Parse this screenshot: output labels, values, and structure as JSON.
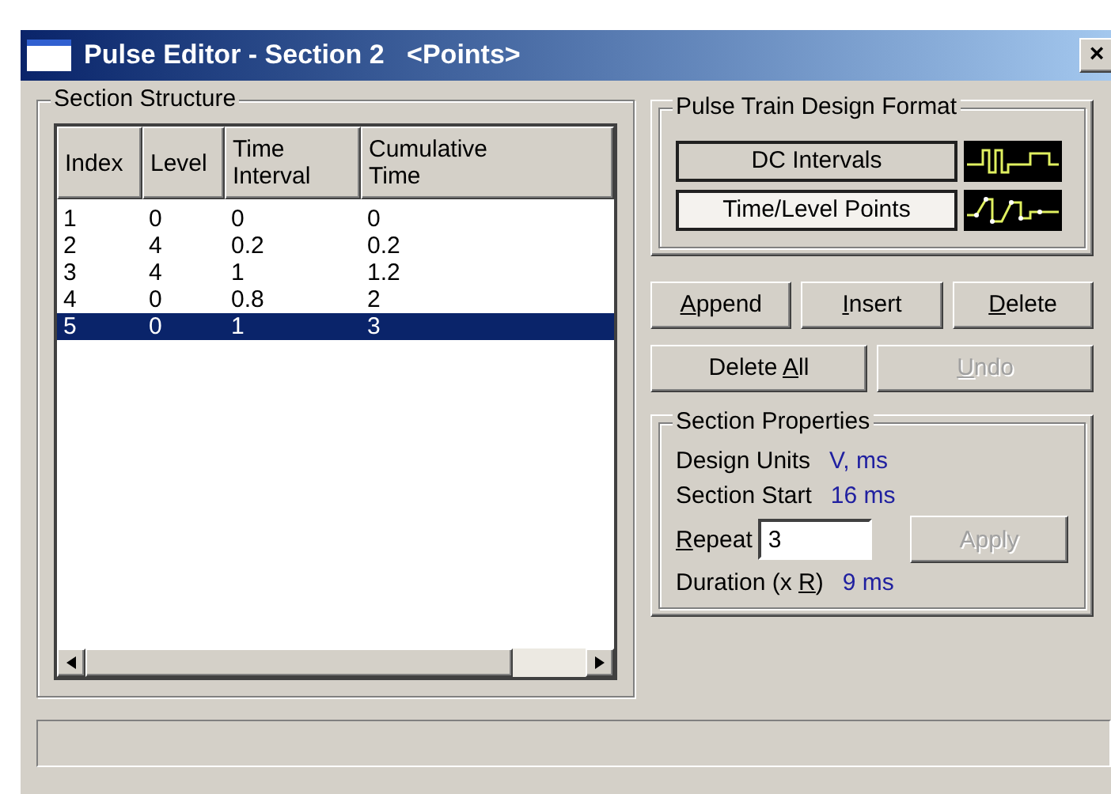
{
  "window": {
    "title": "Pulse Editor - Section 2   <Points>",
    "close": "×"
  },
  "section_structure": {
    "title": "Section Structure",
    "columns": [
      "Index",
      "Level",
      "Time Interval",
      "Cumulative Time"
    ],
    "rows": [
      {
        "cells": [
          "1",
          "0",
          "0",
          "0"
        ],
        "selected": false
      },
      {
        "cells": [
          "2",
          "4",
          "0.2",
          "0.2"
        ],
        "selected": false
      },
      {
        "cells": [
          "3",
          "4",
          "1",
          "1.2"
        ],
        "selected": false
      },
      {
        "cells": [
          "4",
          "0",
          "0.8",
          "2"
        ],
        "selected": false
      },
      {
        "cells": [
          "5",
          "0",
          "1",
          "3"
        ],
        "selected": true
      }
    ]
  },
  "format": {
    "title": "Pulse Train Design Format",
    "options": [
      {
        "label": "DC Intervals",
        "kind": "dc",
        "selected": false
      },
      {
        "label": "Time/Level Points",
        "kind": "points",
        "selected": true
      }
    ]
  },
  "buttons": [
    [
      {
        "label": [
          {
            "text": "A",
            "underlined": true
          },
          {
            "text": "ppend",
            "underlined": false
          }
        ],
        "disabled": false
      },
      {
        "label": [
          {
            "text": "I",
            "underlined": true
          },
          {
            "text": "nsert",
            "underlined": false
          }
        ],
        "disabled": false
      },
      {
        "label": [
          {
            "text": "D",
            "underlined": true
          },
          {
            "text": "elete",
            "underlined": false
          }
        ],
        "disabled": false
      }
    ],
    [
      {
        "label": [
          {
            "text": "Delete ",
            "underlined": false
          },
          {
            "text": "A",
            "underlined": true
          },
          {
            "text": "ll",
            "underlined": false
          }
        ],
        "disabled": false
      },
      {
        "label": [
          {
            "text": "U",
            "underlined": true
          },
          {
            "text": "ndo",
            "underlined": false
          }
        ],
        "disabled": true
      }
    ]
  ],
  "properties": {
    "title": "Section Properties",
    "design_units": {
      "label": "Design Units",
      "value": "V, ms"
    },
    "section_start": {
      "label": "Section Start",
      "value": "16 ms"
    },
    "repeat": {
      "label": [
        {
          "text": "R",
          "underlined": true
        },
        {
          "text": "epeat",
          "underlined": false
        }
      ],
      "value": "3"
    },
    "apply": {
      "label": "Apply",
      "disabled": true
    },
    "duration": {
      "label": [
        {
          "text": "Duration (x ",
          "underlined": false
        },
        {
          "text": "R",
          "underlined": true
        },
        {
          "text": ")",
          "underlined": false
        }
      ],
      "value": "9 ms"
    }
  }
}
